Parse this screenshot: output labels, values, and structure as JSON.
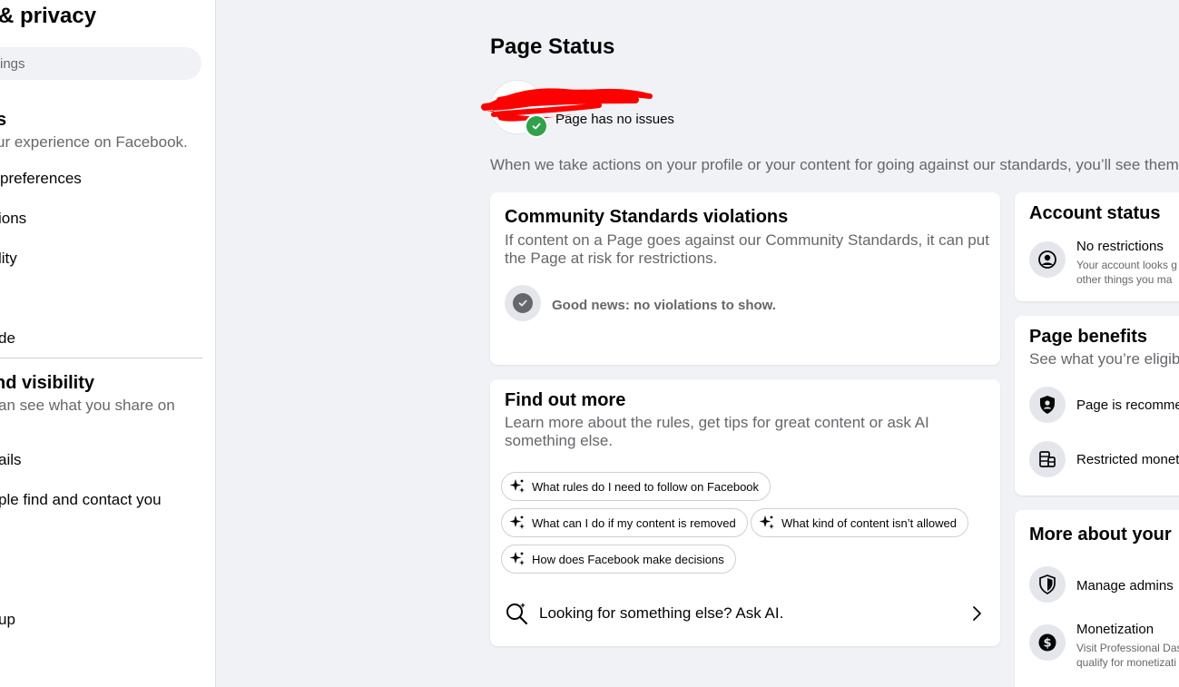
{
  "sidebar": {
    "title": "& privacy",
    "search_placeholder": "ings",
    "section1_title": "s",
    "section1_sub": "ur experience on Facebook.",
    "items_a": [
      "preferences",
      "ions",
      "lity"
    ],
    "item_de": "de",
    "section2_title": "nd visibility",
    "section2_sub": "an see what you share on",
    "items_b": [
      "ails",
      "ple find and contact you"
    ],
    "item_up": "up"
  },
  "page": {
    "title": "Page Status",
    "status_text": "Page has no issues",
    "intro": "When we take actions on your profile or your content for going against our standards, you’ll see them"
  },
  "violations": {
    "title": "Community Standards violations",
    "description": "If content on a Page goes against our Community Standards, it can put the Page at risk for restrictions.",
    "ok_text": "Good news: no violations to show."
  },
  "find_out": {
    "title": "Find out more",
    "description": "Learn more about the rules, get tips for great content or ask AI something else.",
    "chips": [
      "What rules do I need to follow on Facebook",
      "What can I do if my content is removed",
      "What kind of content isn’t allowed",
      "How does Facebook make decisions"
    ],
    "ask_label": "Looking for something else? Ask AI."
  },
  "account_status": {
    "title": "Account status",
    "item_label": "No restrictions",
    "item_desc_1": "Your account looks g",
    "item_desc_2": "other things you ma"
  },
  "page_benefits": {
    "title": "Page benefits",
    "subtitle": "See what you’re eligib",
    "items": [
      "Page is recomme",
      "Restricted monet"
    ]
  },
  "more_about": {
    "title": "More about your",
    "items": [
      "Manage admins",
      "Monetization"
    ],
    "monetization_desc_1": "Visit Professional Das",
    "monetization_desc_2": "qualify for monetizati"
  },
  "colors": {
    "background": "#f0f2f5",
    "card": "#ffffff",
    "success_green": "#31a24c",
    "secondary_text": "#65676b",
    "icon_bg": "#e4e6eb",
    "redaction": "#ff0000"
  },
  "icons": [
    "search-icon",
    "check-circle-icon",
    "sparkle-icon",
    "ask-ai-search-icon",
    "chevron-right-icon",
    "person-circle-icon",
    "shield-person-icon",
    "coins-icon",
    "shield-icon",
    "dollar-icon"
  ]
}
